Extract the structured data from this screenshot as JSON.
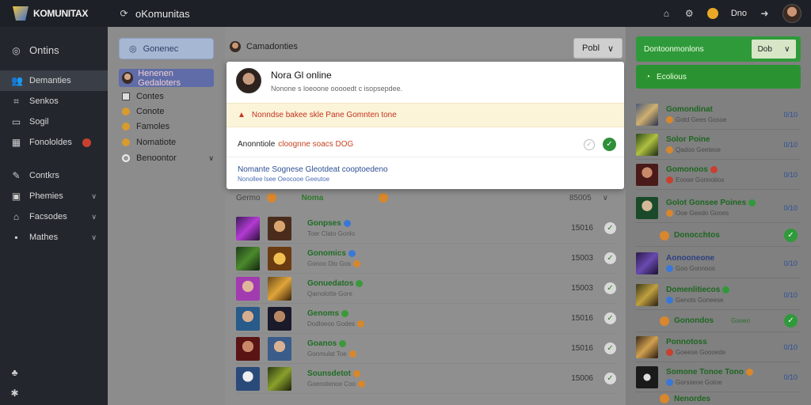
{
  "topbar": {
    "logo": "KOMUNITAX",
    "app_title": "oKomunitas",
    "user_label": "Dno"
  },
  "sidebar": {
    "header": "Ontins",
    "items": [
      {
        "label": "Demanties",
        "icon": "people-icon",
        "active": true
      },
      {
        "label": "Senkos",
        "icon": "chart-icon"
      },
      {
        "label": "Sogil",
        "icon": "card-icon"
      },
      {
        "label": "Fonololdes",
        "icon": "grid-icon",
        "badge": true
      },
      {
        "label": "Contkrs",
        "icon": "tool-icon"
      },
      {
        "label": "Phemies",
        "icon": "folder-icon",
        "chevron": true
      },
      {
        "label": "Facsodes",
        "icon": "lock-icon",
        "chevron": true
      },
      {
        "label": "Mathes",
        "icon": "square-icon",
        "chevron": true
      }
    ]
  },
  "col2": {
    "button": "Gonenec",
    "selected": "Henenen Gedaloters",
    "items": [
      "Contes",
      "Conote",
      "Famoles",
      "Nomatiote",
      "Benoontor"
    ]
  },
  "main": {
    "heading": "Camadonties",
    "dropdown": "Pobl",
    "list_head": {
      "col1": "Germo",
      "col2": "Noma",
      "value": "85005"
    },
    "rows": [
      {
        "t1": "Gonpses",
        "t2": "Toer Clato Gonlo",
        "value": "15016"
      },
      {
        "t1": "Gonomics",
        "t2": "Gonoo Dio Gos",
        "value": "15003"
      },
      {
        "t1": "Gonuedatos",
        "t2": "Qamolotte Gore",
        "value": "15003"
      },
      {
        "t1": "Genoms",
        "t2": "Dodloeoo Godes",
        "value": "15016"
      },
      {
        "t1": "Goanos",
        "t2": "Gonmulat Toe",
        "value": "15016"
      },
      {
        "t1": "Sounsdetot",
        "t2": "Goenotenoe Coo",
        "value": "15006"
      }
    ]
  },
  "modal": {
    "title": "Nora Gl online",
    "subtitle": "Nonone s loeoone ooooedt c isopsepdee.",
    "alert": "Nonndse bakee skle Pane Gomnten tone",
    "row_label": "Anonntiole",
    "row_highlight": "cloognne soacs DOG",
    "link": "Nomante Sognese Gleotdeat cooptoedeno",
    "link2": "Nonollee lsee Oeocooe Geeutoe"
  },
  "right": {
    "banner": "Dontoonmonlons",
    "banner_button": "Dob",
    "banner2": "Ecolious",
    "rows": [
      {
        "t1": "Gomondinat",
        "t2": "Gotd Gees Gosoe",
        "value": "0/10"
      },
      {
        "t1": "Solor Poine",
        "t2": "Qadoo Geeteoe",
        "value": "0/10"
      },
      {
        "t1": "Gomonoos",
        "t2": "Eoose Gonnotios",
        "value": "0/10"
      },
      {
        "t1": "Golot Gonsee Poines",
        "t2": "Ooe Geedo Gooes",
        "value": "0/10"
      },
      {
        "t1": "Donocchtos",
        "t2": "",
        "value": "",
        "check": true
      },
      {
        "t1": "Aonooneone",
        "t2": "Goo Gonnoos",
        "value": "0/10"
      },
      {
        "t1": "Domenlitiecos",
        "t2": "Genots Goneese",
        "value": "0/10"
      },
      {
        "t1": "Gonondos",
        "t2": "Gooeo",
        "value": "",
        "check": true
      },
      {
        "t1": "Ponnotoss",
        "t2": "Goeese Goooede",
        "value": "0/10"
      },
      {
        "t1": "Somone Tonoe Tono",
        "t2": "Gorsseoe Gotoe",
        "value": "0/10"
      },
      {
        "t1": "Nenordes",
        "t2": "",
        "value": ""
      }
    ]
  },
  "colors": {
    "accent_green": "#2f9a3a",
    "sidebar": "#23272d",
    "alert_red": "#c4331f"
  }
}
